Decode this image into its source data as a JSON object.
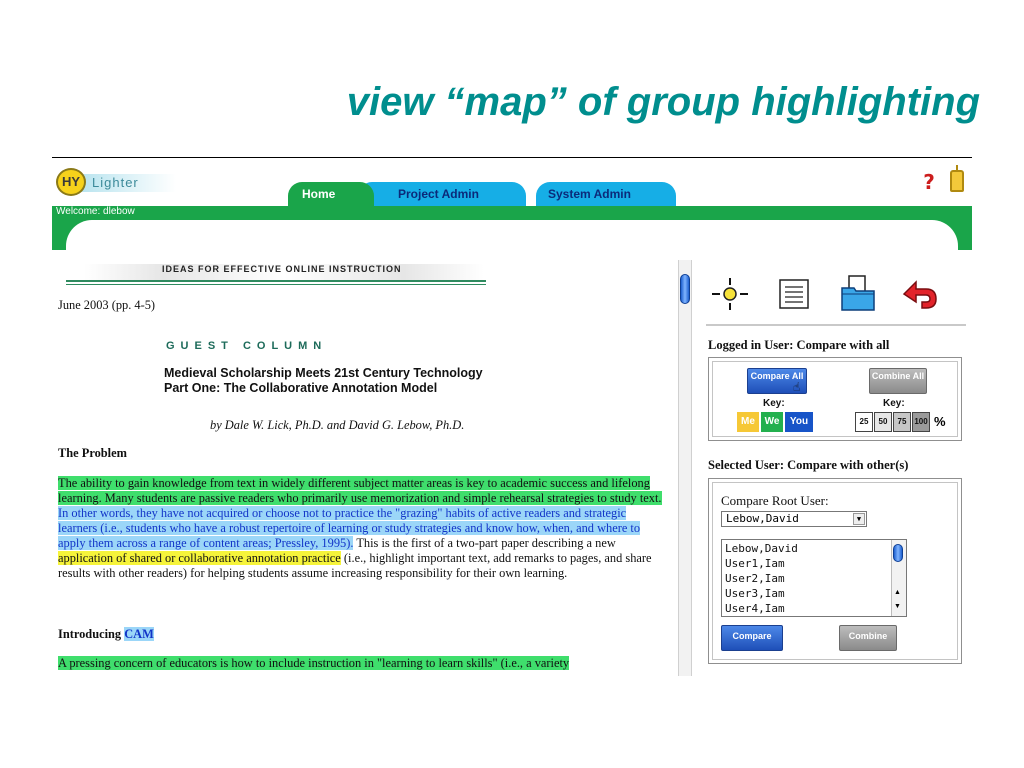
{
  "slide": {
    "title": "view “map” of group highlighting"
  },
  "app": {
    "logo_hy": "HY",
    "logo_text": "Lighter",
    "tabs": [
      {
        "label": "Home",
        "active": true
      },
      {
        "label": "Project Admin",
        "active": false
      },
      {
        "label": "System Admin",
        "active": false
      }
    ],
    "welcome": "Welcome: dlebow",
    "help_icon": "?",
    "colors": {
      "green": "#1aa54a",
      "tab_blue": "#16aee6",
      "title_teal": "#008e8e"
    }
  },
  "document": {
    "banner": "IDEAS FOR EFFECTIVE ONLINE INSTRUCTION",
    "date": "June 2003 (pp. 4-5)",
    "guest": "GUEST COLUMN",
    "subtitle_line1": "Medieval Scholarship Meets 21st Century Technology",
    "subtitle_line2": "Part One:  The Collaborative Annotation Model",
    "author": "by Dale W. Lick, Ph.D. and David G. Lebow, Ph.D.",
    "heading_problem": "The Problem",
    "para1_green": "The ability to gain knowledge from text in widely different subject matter areas is key to academic success and lifelong learning.  Many students are passive readers who primarily use memorization and simple rehearsal strategies to study text.",
    "para1_blue": " In other words, they have not acquired or choose not to practice the \"grazing\" habits of active readers and strategic learners (i.e., students who have a robust repertoire of learning or study strategies and know how, when, and where to apply them across a range of content areas; Pressley, 1995).",
    "para1_plain1": "  This is the first of a two-part paper describing a new ",
    "para1_yellow": "application of shared or collaborative annotation practice",
    "para1_plain2": " (i.e., highlight important text, add remarks to pages, and share results with other readers) for helping students assume increasing responsibility for their own learning.",
    "heading_intro": "Introducing ",
    "heading_intro_cam": "CAM",
    "para2": "A pressing concern of educators is how to include instruction in \"learning to learn skills\" (i.e., a variety"
  },
  "panel": {
    "tools": [
      "highlight-sun-icon",
      "notes-icon",
      "folder-icon",
      "back-arrow-icon"
    ],
    "logged_in_heading": "Logged in User: Compare with all",
    "compare_all": "Compare All",
    "combine_all": "Combine All",
    "key_label": "Key:",
    "key_me": "Me",
    "key_we": "We",
    "key_you": "You",
    "pct_values": [
      "25",
      "50",
      "75",
      "100"
    ],
    "pct_symbol": "%",
    "selected_heading": "Selected User: Compare with other(s)",
    "compare_root_label": "Compare Root User:",
    "root_selected": "Lebow,David",
    "users": [
      "Lebow,David",
      "User1,Iam",
      "User2,Iam",
      "User3,Iam",
      "User4,Iam"
    ],
    "compare_button": "Compare",
    "combine_button": "Combine"
  }
}
